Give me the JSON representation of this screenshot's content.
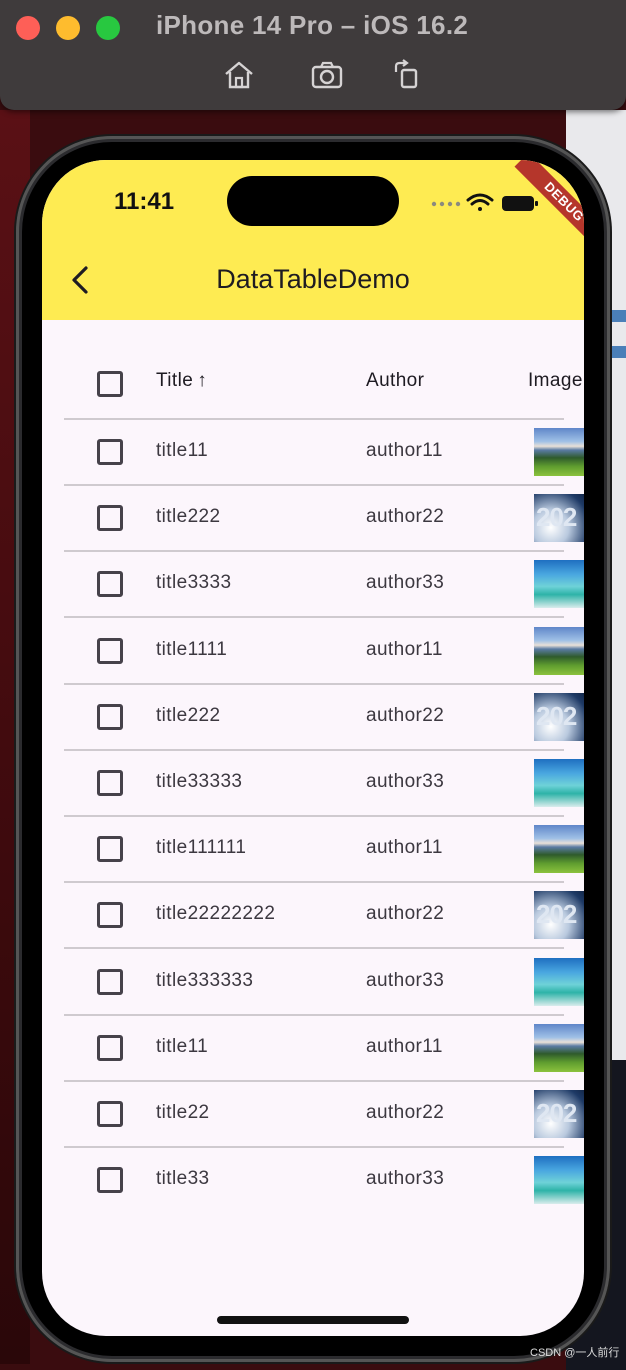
{
  "simulator": {
    "title": "iPhone 14 Pro – iOS 16.2",
    "buttons": [
      "home-icon",
      "screenshot-icon",
      "rotate-icon"
    ]
  },
  "status_bar": {
    "time": "11:41",
    "debug_banner": "DEBUG"
  },
  "app_bar": {
    "title": "DataTableDemo",
    "background": "#feeb52",
    "back_icon": "chevron-left-icon"
  },
  "table": {
    "columns": [
      "Title",
      "Author",
      "Image"
    ],
    "sort_column": "Title",
    "sort_icon": "arrow-up-icon",
    "rows": [
      {
        "title": "title11",
        "author": "author11",
        "image": "mountain"
      },
      {
        "title": "title222",
        "author": "author22",
        "image": "snow2024"
      },
      {
        "title": "title3333",
        "author": "author33",
        "image": "beach"
      },
      {
        "title": "title1111",
        "author": "author11",
        "image": "mountain"
      },
      {
        "title": "title222",
        "author": "author22",
        "image": "snow2024"
      },
      {
        "title": "title33333",
        "author": "author33",
        "image": "beach"
      },
      {
        "title": "title111111",
        "author": "author11",
        "image": "mountain"
      },
      {
        "title": "title22222222",
        "author": "author22",
        "image": "snow2024"
      },
      {
        "title": "title333333",
        "author": "author33",
        "image": "beach"
      },
      {
        "title": "title11",
        "author": "author11",
        "image": "mountain"
      },
      {
        "title": "title22",
        "author": "author22",
        "image": "snow2024"
      },
      {
        "title": "title33",
        "author": "author33",
        "image": "beach"
      }
    ]
  },
  "thumb_text": "202",
  "watermark": "CSDN @一人前行"
}
